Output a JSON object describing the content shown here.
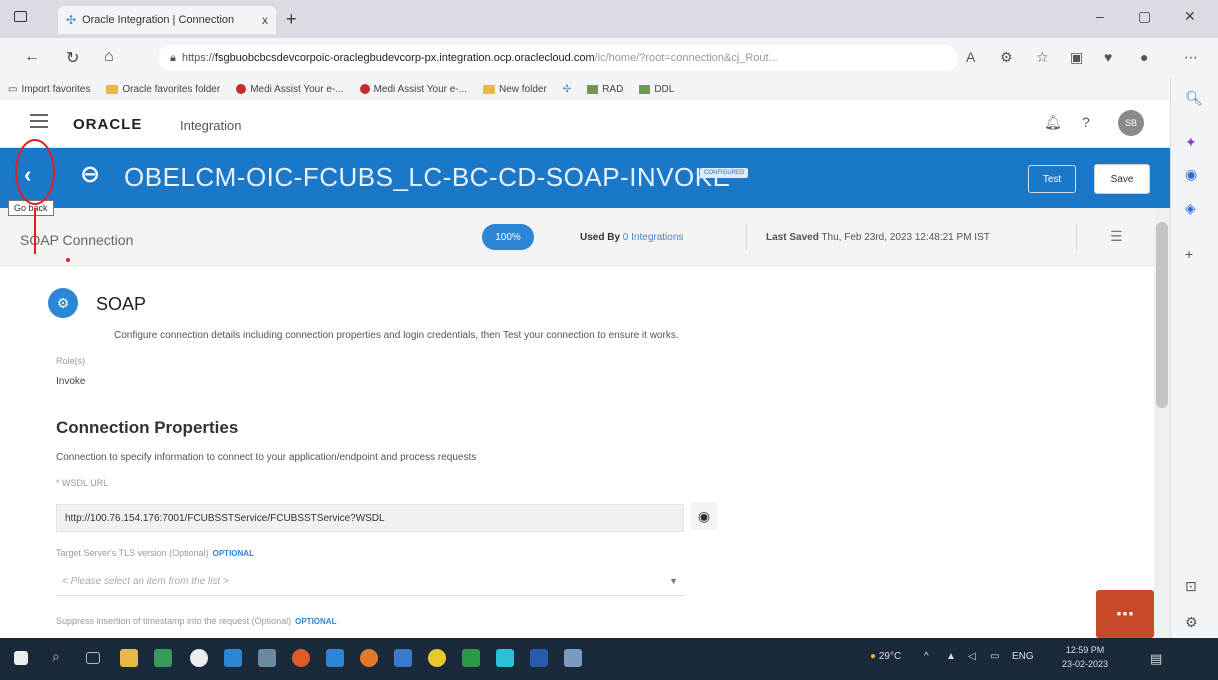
{
  "browser": {
    "tab_title": "Oracle Integration | Connection",
    "tab_close": "x",
    "new_tab": "+",
    "url_prefix": "https://",
    "url_domain": "fsgbuobcbcsdevcorpoic-oraclegbudevcorp-px.integration.ocp.oraclecloud.com",
    "url_path": "/ic/home/?root=connection&cj_Rout...",
    "favorites": [
      "Import favorites",
      "Oracle favorites folder",
      "Medi Assist Your e-...",
      "Medi Assist Your e-...",
      "New folder",
      "RAD",
      "DDL"
    ]
  },
  "app": {
    "logo": "ORACLE",
    "logo_sub": "Integration",
    "help": "?",
    "avatar": "SB"
  },
  "connection": {
    "title": "OBELCM-OIC-FCUBS_LC-BC-CD-SOAP-INVOKE",
    "badge": "CONFIGURED",
    "test_label": "Test",
    "save_label": "Save",
    "back_tooltip": "Go back"
  },
  "subbar": {
    "title": "SOAP Connection",
    "percent": "100%",
    "used_by_label": "Used By",
    "used_by_value": "0 Integrations",
    "last_saved_label": "Last Saved",
    "last_saved_value": "Thu, Feb 23rd, 2023 12:48:21 PM IST"
  },
  "content": {
    "adapter_title": "SOAP",
    "adapter_desc": "Configure connection details including connection properties and login credentials, then Test your connection to ensure it works.",
    "roles_label": "Role(s)",
    "roles_value": "Invoke",
    "section_title": "Connection Properties",
    "section_desc": "Connection to specify information to connect to your application/endpoint and process requests",
    "wsdl_label": "* WSDL URL",
    "wsdl_value": "http://100.76.154.176:7001/FCUBSSTService/FCUBSSTService?WSDL",
    "tls_label": "Target Server's TLS version (Optional)",
    "optional": "OPTIONAL",
    "tls_placeholder": "< Please select an item from the list >",
    "timestamp_label": "Suppress insertion of timestamp into the request (Optional)"
  },
  "taskbar": {
    "weather": "29°C",
    "lang": "ENG",
    "time": "12:59 PM",
    "date": "23-02-2023"
  },
  "icons": {
    "back": "chevron-left-icon",
    "connection": "connection-icon",
    "eye": "eye-icon",
    "chat": "chat-icon"
  }
}
